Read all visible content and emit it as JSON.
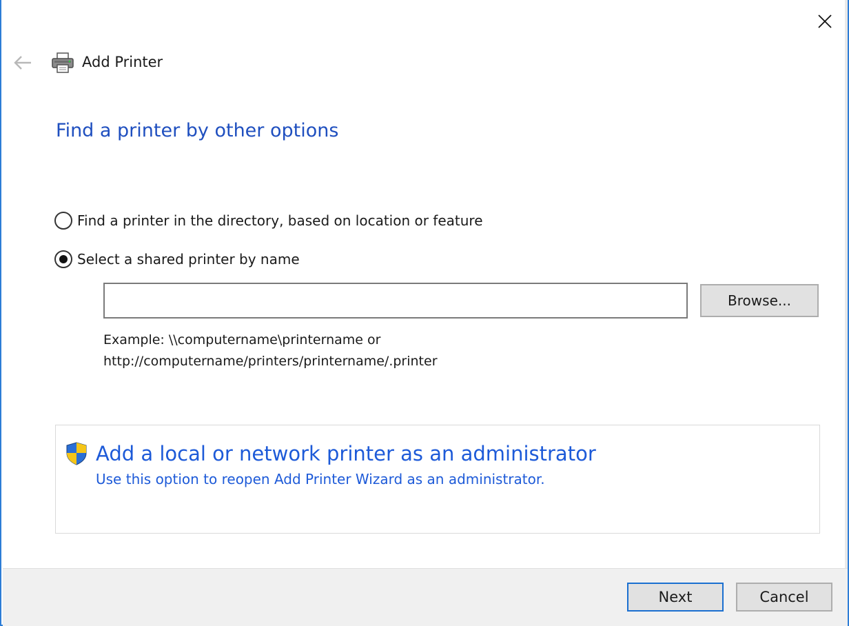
{
  "window": {
    "title": "Add Printer",
    "close_icon": "close-icon",
    "back_icon": "arrow-left-icon",
    "app_icon": "printer-icon"
  },
  "page": {
    "heading": "Find a printer by other options"
  },
  "options": [
    {
      "label": "Find a printer in the directory, based on location or feature",
      "selected": false
    },
    {
      "label": "Select a shared printer by name",
      "selected": true
    }
  ],
  "shared_printer": {
    "value": "",
    "placeholder": "",
    "browse_label": "Browse...",
    "example_line1": "Example: \\\\computername\\printername or",
    "example_line2": "http://computername/printers/printername/.printer"
  },
  "admin_link": {
    "icon": "uac-shield-icon",
    "title": "Add a local or network printer as an administrator",
    "subtitle": "Use this option to reopen Add Printer Wizard as an administrator."
  },
  "footer": {
    "next_label": "Next",
    "cancel_label": "Cancel"
  },
  "colors": {
    "heading": "#1f4fbf",
    "link": "#1d5ad8",
    "window_border": "#2d7dd6",
    "footer_bg": "#f0f0f0",
    "default_button_border": "#1a6fd0"
  }
}
